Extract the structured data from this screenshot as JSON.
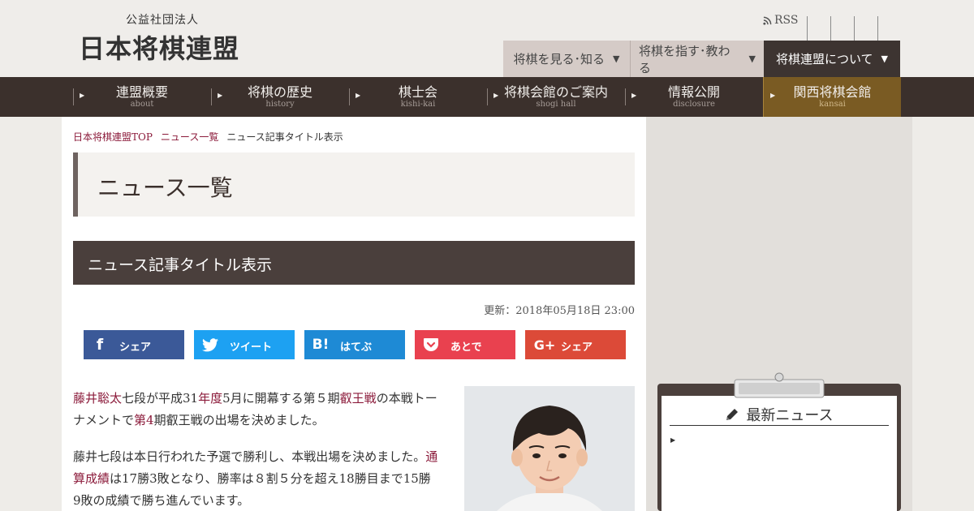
{
  "header": {
    "logo_sub": "公益社団法人",
    "logo_main": "日本将棋連盟",
    "rss_label": "RSS",
    "top_tabs": [
      {
        "label": "将棋を見る･知る"
      },
      {
        "label": "将棋を指す･教わる"
      },
      {
        "label": "将棋連盟について"
      }
    ],
    "tab_arrow": "▼"
  },
  "nav": {
    "arrow": "▶",
    "items": [
      {
        "jp": "連盟概要",
        "en": "about"
      },
      {
        "jp": "将棋の歴史",
        "en": "history"
      },
      {
        "jp": "棋士会",
        "en": "kishi-kai"
      },
      {
        "jp": "将棋会館のご案内",
        "en": "shogi hall"
      },
      {
        "jp": "情報公開",
        "en": "disclosure"
      },
      {
        "jp": "関西将棋会館",
        "en": "kansai"
      }
    ]
  },
  "breadcrumb": {
    "home": "日本将棋連盟TOP",
    "section": "ニュース一覧",
    "current": "ニュース記事タイトル表示"
  },
  "page_title": "ニュース一覧",
  "article": {
    "title": "ニュース記事タイトル表示",
    "date": "更新：2018年05月18日 23:00",
    "share_buttons": [
      {
        "label": "シェア",
        "icon": "f"
      },
      {
        "label": "ツイート",
        "icon": "twitter-bird"
      },
      {
        "label": "はてぶ",
        "icon": "B!"
      },
      {
        "label": "あとで",
        "icon": "pocket"
      },
      {
        "label": "シェア",
        "icon": "G+"
      }
    ],
    "p1_parts": [
      "藤井聡太",
      "七段が平成31",
      "年度",
      "5月に開幕する第５期",
      "叡王戦",
      "の本戦トーナメントで",
      "第4",
      "期叡王",
      "戦の出場を決めました。"
    ],
    "p2": "藤井七段は本日行われた予選で勝利し、本戦出場を決めました。",
    "p2_parts": [
      "藤井七段は本日行われた予選で勝利し、本戦出場を決めました。",
      "通算成績",
      "は17勝3敗となり、勝率は８割５分を",
      "超え18勝目まで15勝9敗の成績で勝ち進んでいます。"
    ]
  },
  "sidebar": {
    "title": "最新ニュース"
  },
  "colors": {
    "nav_bg": "#3b302c",
    "kansai": "#7a5b23",
    "link": "#8b1a3a",
    "facebook": "#3b5998",
    "twitter": "#1da1f2",
    "hatena": "#1e8ad5",
    "pocket": "#e9414f",
    "google": "#dc4a38"
  }
}
